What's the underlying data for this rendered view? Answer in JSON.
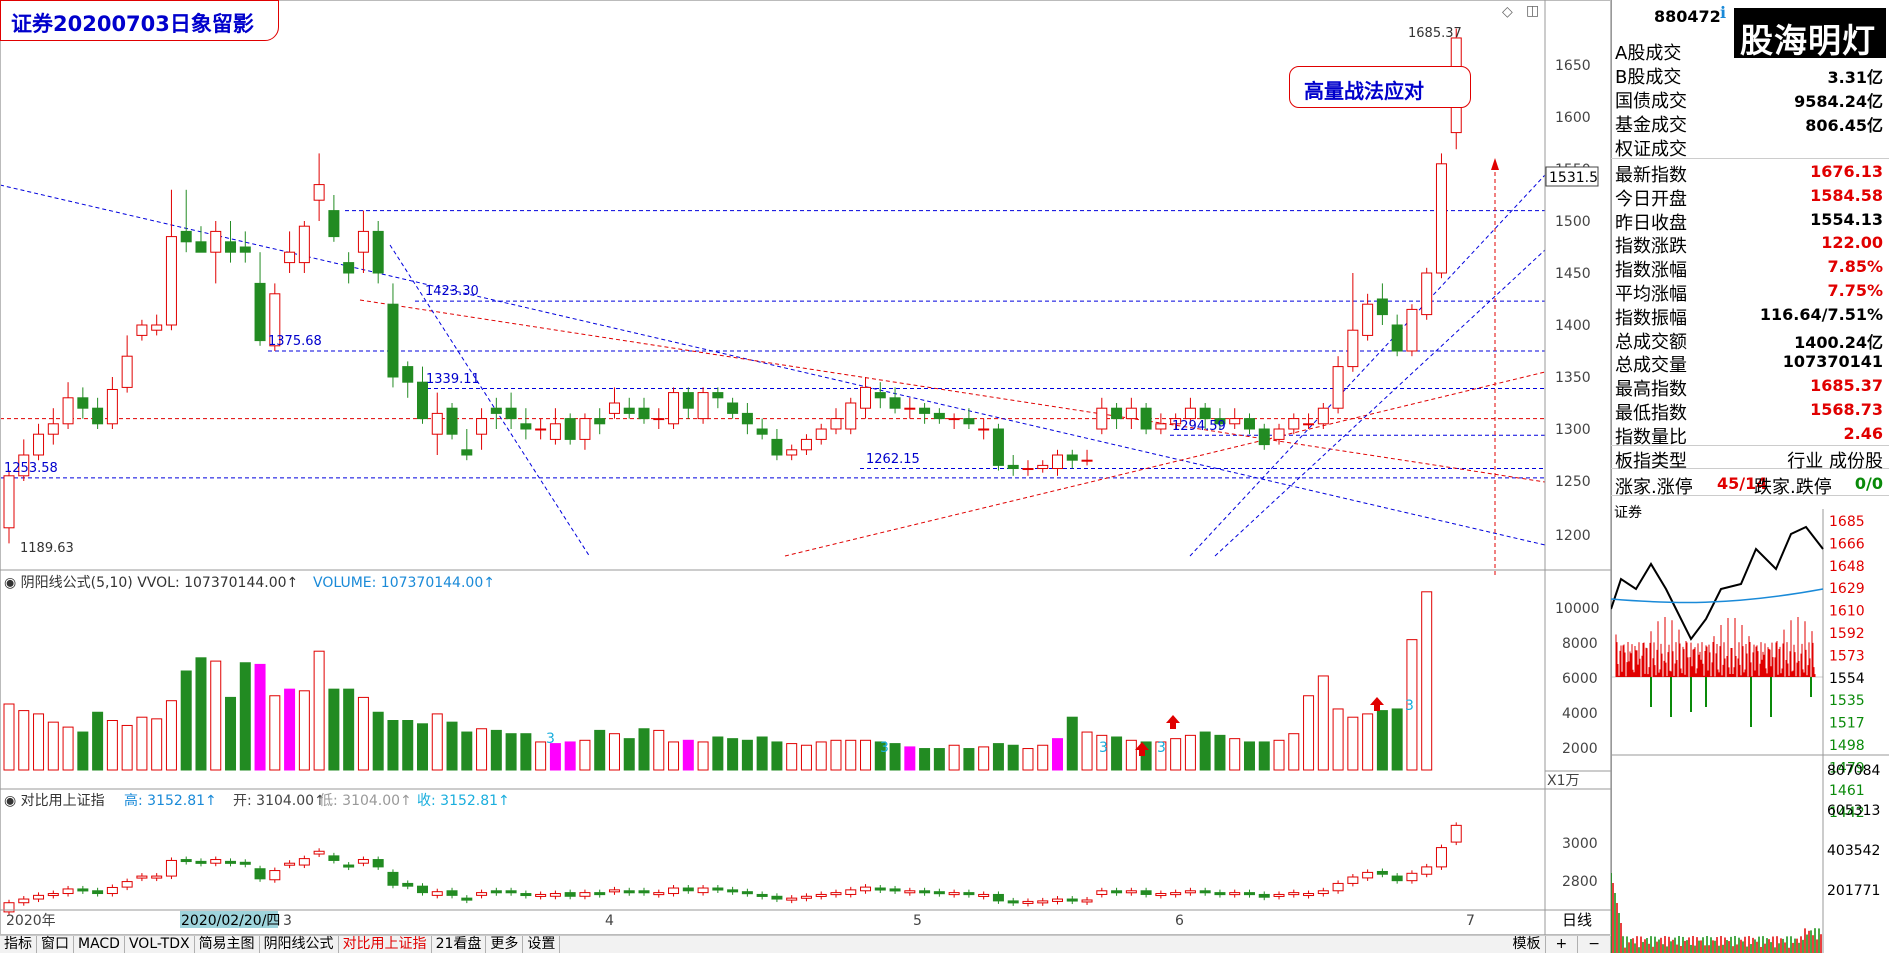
{
  "chart_title": "证券20200703日象留影",
  "annotation": "高量战法应对",
  "main_chart": {
    "price_axis": [
      "1650",
      "1600",
      "1550",
      "1500",
      "1450",
      "1400",
      "1350",
      "1300",
      "1250",
      "1200"
    ],
    "labels": {
      "high": "1685.37",
      "low": "1189.63",
      "l1423": "1423.30",
      "l1375": "1375.68",
      "l1339": "1339.11",
      "l1294": "1294.59",
      "l1262": "1262.15",
      "l1253": "1253.58"
    },
    "right_price_box": "1531.5"
  },
  "vol_panel": {
    "header": "◉ 阴阳线公式(5,10)   VVOL: 107370144.00↑",
    "volume_label": "VOLUME: 107370144.00↑",
    "axis": [
      "10000",
      "8000",
      "6000",
      "4000",
      "2000"
    ],
    "unit": "X1万",
    "marks": [
      "3",
      "3",
      "3",
      "3",
      "3"
    ]
  },
  "cmp_panel": {
    "header": "◉ 对比用上证指",
    "high": "高: 3152.81↑",
    "open": "开: 3104.00↑",
    "low": "低: 3104.00↑",
    "close": "收: 3152.81↑",
    "axis": [
      "3000",
      "2800"
    ]
  },
  "x_axis": {
    "year": "2020年",
    "cursor_date": "2020/02/20/四",
    "months": [
      "3",
      "4",
      "5",
      "6",
      "7"
    ]
  },
  "period_label": "日线",
  "bottom_tabs": [
    "指标",
    "窗口",
    "MACD",
    "VOL-TDX",
    "简易主图",
    "阴阳线公式",
    "对比用上证指",
    "21看盘",
    "更多",
    "设置"
  ],
  "active_tab": "对比用上证指",
  "bottom_right": [
    "模板",
    "+",
    "−"
  ],
  "right_panel": {
    "code": "880472",
    "logo": "股海明灯",
    "trade_rows": [
      {
        "label": "A股成交",
        "value": ""
      },
      {
        "label": "B股成交",
        "value": "3.31亿"
      },
      {
        "label": "国债成交",
        "value": "9584.24亿"
      },
      {
        "label": "基金成交",
        "value": "806.45亿"
      },
      {
        "label": "权证成交",
        "value": ""
      }
    ],
    "index_rows": [
      {
        "label": "最新指数",
        "value": "1676.13",
        "color": "#e00000"
      },
      {
        "label": "今日开盘",
        "value": "1584.58",
        "color": "#e00000"
      },
      {
        "label": "昨日收盘",
        "value": "1554.13",
        "color": "#000000"
      },
      {
        "label": "指数涨跌",
        "value": "122.00",
        "color": "#e00000"
      },
      {
        "label": "指数涨幅",
        "value": "7.85%",
        "color": "#e00000"
      },
      {
        "label": "平均涨幅",
        "value": "7.75%",
        "color": "#e00000"
      },
      {
        "label": "指数振幅",
        "value": "116.64/7.51%",
        "color": "#000000"
      },
      {
        "label": "总成交额",
        "value": "1400.24亿",
        "color": "#000000"
      },
      {
        "label": "总成交量",
        "value": "107370141",
        "color": "#000000"
      },
      {
        "label": "最高指数",
        "value": "1685.37",
        "color": "#e00000"
      },
      {
        "label": "最低指数",
        "value": "1568.73",
        "color": "#e00000"
      },
      {
        "label": "指数量比",
        "value": "2.46",
        "color": "#e00000"
      }
    ],
    "board_type_label": "板指类型",
    "board_type_value": "行业 成份股",
    "up_label": "涨家.涨停",
    "up_value": "45/14",
    "down_label": "跌家.跌停",
    "down_value": "0/0",
    "mini_title": "证券",
    "mini_axis": [
      "1685",
      "1666",
      "1648",
      "1629",
      "1610",
      "1592",
      "1573",
      "1554",
      "1535",
      "1517",
      "1498",
      "1479",
      "1461",
      "1442"
    ],
    "mini_vol_axis": [
      "807084",
      "605313",
      "403542",
      "201771"
    ]
  },
  "colors": {
    "up": "#e00000",
    "down": "#228b22",
    "magenta": "#ff00ff",
    "blue_line": "#0000dd",
    "red_line": "#e00000"
  }
}
